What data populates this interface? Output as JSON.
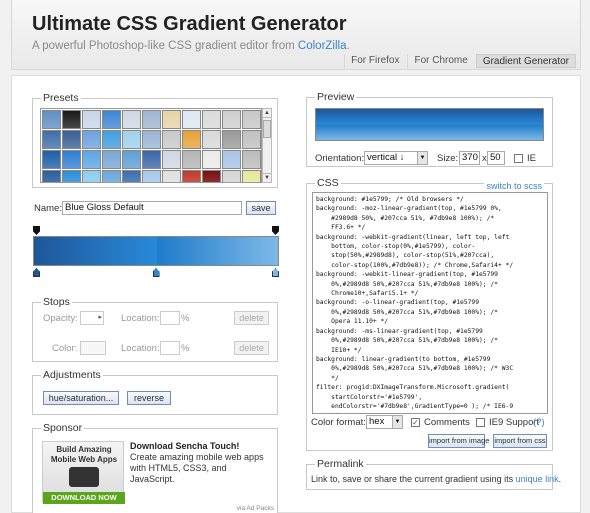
{
  "app": {
    "title": "Ultimate CSS Gradient Generator",
    "subtitle_prefix": "A powerful Photoshop-like CSS gradient editor from ",
    "subtitle_link": "ColorZilla",
    "subtitle_suffix": "."
  },
  "nav": {
    "tabs": [
      "For Firefox",
      "For Chrome",
      "Gradient Generator"
    ],
    "active": "Gradient Generator"
  },
  "presets": {
    "legend": "Presets",
    "swatches": [
      [
        "#5f8fc4",
        "#1a1a1a",
        "#c9d6e8",
        "#3d86d6",
        "#cfd8e3",
        "#9fb6d3",
        "#e7d3a6",
        "#dfe7f2",
        "#dadada",
        "#cfcfcf",
        "#c7c7c7"
      ],
      [
        "#3e6fa9",
        "#3a5f96",
        "#6da2df",
        "#3f9fe0",
        "#9fd1ee",
        "#9ab5d6",
        "#c9c9c9",
        "#e7a238",
        "#d8d8d8",
        "#9a9a9a",
        "#c0c0c0"
      ],
      [
        "#1e5fa8",
        "#2f7fd5",
        "#5ca6e6",
        "#7aa7d3",
        "#5f9fd6",
        "#3a66a8",
        "#cfd8e3",
        "#b5b5b5",
        "#ebebeb",
        "#a8c4e8",
        "#bbbbbb"
      ],
      [
        "#2a5f9e",
        "#2f8fd6",
        "#8ccdf0",
        "#6ba9dc",
        "#3d6fb0",
        "#a4c9ef",
        "#e0e0e0",
        "#c23a2a",
        "#7a1010",
        "#d6d6d6",
        "#e8e89a"
      ],
      [
        "#2f73c4",
        "#5ba6e6",
        "#60b6e8",
        "#8cc8ef",
        "#4aa9e0",
        "#73c4ef",
        "#7a5a2a",
        "#8a8a2a",
        "#2a7a3a",
        "#3a9a3a",
        "#f3f07a"
      ]
    ],
    "name_label": "Name:",
    "name_value": "Blue Gloss Default",
    "save_label": "save"
  },
  "gradient": {
    "stops": [
      {
        "color": "#1e5799",
        "pos": 0
      },
      {
        "color": "#2989d8",
        "pos": 50
      },
      {
        "color": "#207cca",
        "pos": 51
      },
      {
        "color": "#7db9e8",
        "pos": 100
      }
    ],
    "opacity_markers": [
      0,
      100
    ]
  },
  "stops_panel": {
    "legend": "Stops",
    "opacity_label": "Opacity:",
    "location_label": "Location:",
    "color_label": "Color:",
    "percent": "%",
    "delete_label": "delete"
  },
  "adjustments": {
    "legend": "Adjustments",
    "hue_label": "hue/saturation...",
    "reverse_label": "reverse"
  },
  "sponsor": {
    "legend": "Sponsor",
    "ad_line1": "Build Amazing",
    "ad_line2": "Mobile Web Apps",
    "ad_button": "DOWNLOAD NOW",
    "headline": "Download Sencha Touch!",
    "body": "Create amazing mobile web apps with HTML5, CSS3, and JavaScript.",
    "credit": "via Ad Packs"
  },
  "preview": {
    "legend": "Preview",
    "orientation_label": "Orientation:",
    "orientation_value": "vertical ↓",
    "size_label": "Size:",
    "width": "370",
    "x": "x",
    "height": "50",
    "ie_label": "IE"
  },
  "css_panel": {
    "legend": "CSS",
    "switch_label": "switch to scss",
    "lines": [
      "background: #1e5799; /* Old browsers */",
      "background: -moz-linear-gradient(top, #1e5799 0%,",
      "    #2989d8 50%, #207cca 51%, #7db9e8 100%); /*",
      "    FF3.6+ */",
      "background: -webkit-gradient(linear, left top, left",
      "    bottom, color-stop(0%,#1e5799), color-",
      "    stop(50%,#2989d8), color-stop(51%,#207cca),",
      "    color-stop(100%,#7db9e8)); /* Chrome,Safari4+ */",
      "background: -webkit-linear-gradient(top, #1e5799",
      "    0%,#2989d8 50%,#207cca 51%,#7db9e8 100%); /*",
      "    Chrome10+,Safari5.1+ */",
      "background: -o-linear-gradient(top, #1e5799",
      "    0%,#2989d8 50%,#207cca 51%,#7db9e8 100%); /*",
      "    Opera 11.10+ */",
      "background: -ms-linear-gradient(top, #1e5799",
      "    0%,#2989d8 50%,#207cca 51%,#7db9e8 100%); /*",
      "    IE10+ */",
      "background: linear-gradient(to bottom, #1e5799",
      "    0%,#2989d8 50%,#207cca 51%,#7db9e8 100%); /* W3C",
      "    */",
      "filter: progid:DXImageTransform.Microsoft.gradient(",
      "    startColorstr='#1e5799',",
      "    endColorstr='#7db9e8',GradientType=0 ); /* IE6-9",
      "    */"
    ],
    "color_format_label": "Color format:",
    "color_format_value": "hex",
    "comments_label": "Comments",
    "ie9_label": "IE9 Support",
    "ie9_help": "(?)",
    "import_image": "import from image",
    "import_css": "import from css"
  },
  "permalink": {
    "legend": "Permalink",
    "text_prefix": "Link to, save or share the current gradient using its ",
    "link": "unique link",
    "text_suffix": "."
  },
  "colors": {
    "accent": "#3a84c9",
    "ad_green": "#5aa51c"
  }
}
